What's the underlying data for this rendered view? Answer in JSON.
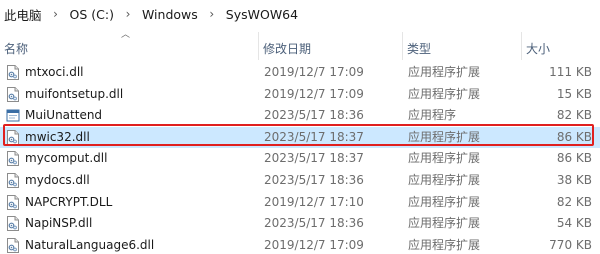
{
  "breadcrumb": [
    "此电脑",
    "OS (C:)",
    "Windows",
    "SysWOW64"
  ],
  "columns": {
    "name": "名称",
    "date": "修改日期",
    "type": "类型",
    "size": "大小"
  },
  "files": [
    {
      "icon": "dll-file-icon",
      "name": "mtxoci.dll",
      "date": "2019/12/7 17:09",
      "type": "应用程序扩展",
      "size": "111 KB"
    },
    {
      "icon": "dll-file-icon",
      "name": "muifontsetup.dll",
      "date": "2019/12/7 17:09",
      "type": "应用程序扩展",
      "size": "15 KB"
    },
    {
      "icon": "application-icon",
      "name": "MuiUnattend",
      "date": "2023/5/17 18:36",
      "type": "应用程序",
      "size": "82 KB"
    },
    {
      "icon": "dll-file-icon",
      "name": "mwic32.dll",
      "date": "2023/5/17 18:37",
      "type": "应用程序扩展",
      "size": "86 KB",
      "selected": true
    },
    {
      "icon": "dll-file-icon",
      "name": "mycomput.dll",
      "date": "2023/5/17 18:37",
      "type": "应用程序扩展",
      "size": "86 KB"
    },
    {
      "icon": "dll-file-icon",
      "name": "mydocs.dll",
      "date": "2023/5/17 18:36",
      "type": "应用程序扩展",
      "size": "38 KB"
    },
    {
      "icon": "dll-file-icon",
      "name": "NAPCRYPT.DLL",
      "date": "2019/12/7 17:10",
      "type": "应用程序扩展",
      "size": "82 KB"
    },
    {
      "icon": "dll-file-icon",
      "name": "NapiNSP.dll",
      "date": "2023/5/17 18:36",
      "type": "应用程序扩展",
      "size": "54 KB"
    },
    {
      "icon": "dll-file-icon",
      "name": "NaturalLanguage6.dll",
      "date": "2019/12/7 17:09",
      "type": "应用程序扩展",
      "size": "770 KB"
    }
  ],
  "colors": {
    "selection": "#cce8ff",
    "highlight_border": "#e0201f",
    "header_text": "#4c607a"
  }
}
